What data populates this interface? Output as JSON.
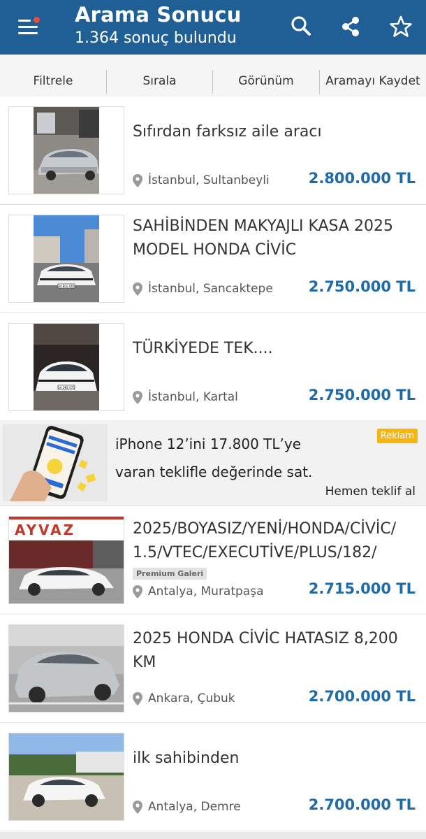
{
  "header": {
    "title": "Arama Sonucu",
    "subtitle": "1.364 sonuç bulundu",
    "icons": {
      "menu": "hamburger-menu-icon",
      "search": "search-icon",
      "share": "share-icon",
      "favorite": "star-icon"
    },
    "notification_dot_color": "#e74c3c",
    "background_color": "#1f5f95"
  },
  "toolbar": {
    "filter": "Filtrele",
    "sort": "Sırala",
    "view": "Görünüm",
    "save_search": "Aramayı Kaydet"
  },
  "listings": [
    {
      "title": "Sıfırdan farksız aile aracı",
      "location": "İstanbul, Sultanbeyli",
      "price": "2.800.000 TL"
    },
    {
      "title": "SAHİBİNDEN MAKYAJLI KASA 2025 MODEL HONDA CİVİC",
      "location": "İstanbul, Sancaktepe",
      "price": "2.750.000 TL"
    },
    {
      "title": "TÜRKİYEDE TEK....",
      "location": "İstanbul, Kartal",
      "price": "2.750.000 TL"
    },
    {
      "title": "2025/BOYASIZ/YENİ/HONDA/CİVİC/ 1.5/VTEC/EXECUTİVE/PLUS/182/",
      "badge": "Premium Galeri",
      "location": "Antalya, Muratpaşa",
      "price": "2.715.000 TL"
    },
    {
      "title": "2025 HONDA CİVİC HATASIZ 8,200 KM",
      "location": "Ankara, Çubuk",
      "price": "2.700.000 TL"
    },
    {
      "title": "ilk sahibinden",
      "location": "Antalya, Demre",
      "price": "2.700.000 TL"
    }
  ],
  "ad": {
    "line1": "iPhone 12’ini 17.800 TL’ye",
    "line2": "varan teklifle değerinde sat.",
    "badge": "Reklam",
    "cta": "Hemen teklif al",
    "badge_color": "#f6b511"
  },
  "thumbnails": {
    "l4_sign_text": "AYVAZ",
    "l2_plate": "34 BCE 065",
    "l3_plate": "34 ORE 075"
  },
  "colors": {
    "price": "#1f6aa9",
    "accent": "#1f5f95"
  }
}
